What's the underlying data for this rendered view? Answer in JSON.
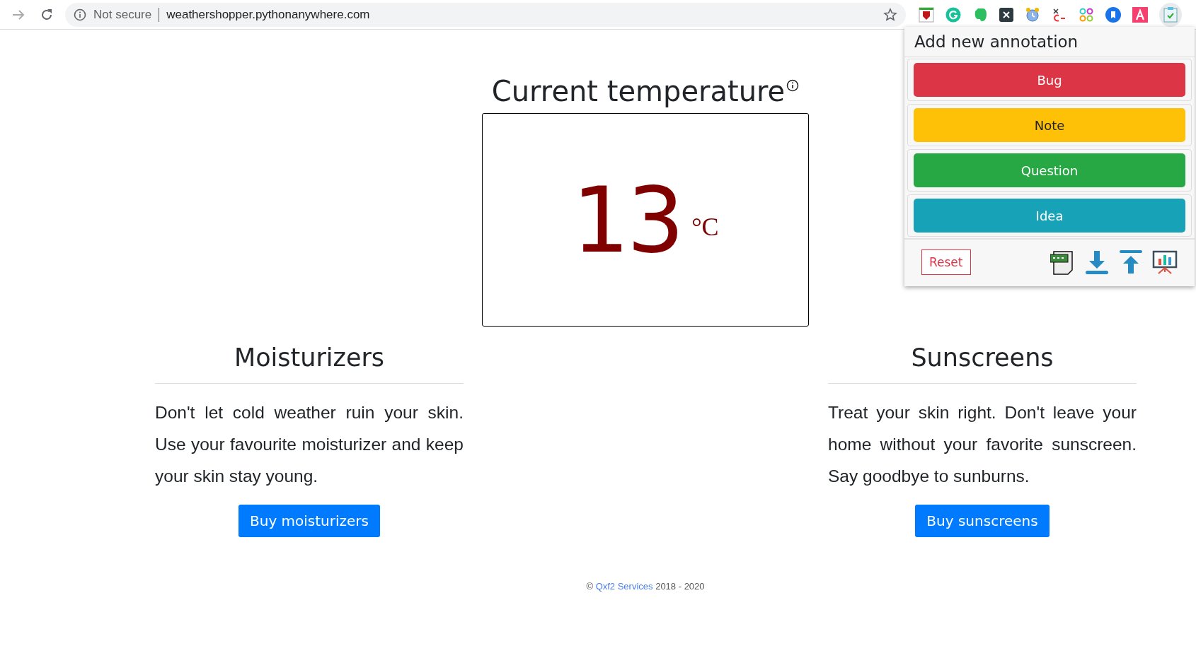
{
  "browser": {
    "security_label": "Not secure",
    "url": "weathershopper.pythonanywhere.com"
  },
  "annotation_popup": {
    "title": "Add new annotation",
    "buttons": [
      {
        "kind": "bug",
        "label": "Bug"
      },
      {
        "kind": "note",
        "label": "Note"
      },
      {
        "kind": "question",
        "label": "Question"
      },
      {
        "kind": "idea",
        "label": "Idea"
      }
    ],
    "reset": "Reset"
  },
  "temperature": {
    "heading": "Current temperature",
    "value": "13",
    "unit": "°C"
  },
  "products": [
    {
      "title": "Moisturizers",
      "description": "Don't let cold weather ruin your skin. Use your favourite moisturizer and keep your skin stay young.",
      "button": "Buy moisturizers"
    },
    {
      "title": "Sunscreens",
      "description": "Treat your skin right. Don't leave your home without your favorite sunscreen. Say goodbye to sunburns.",
      "button": "Buy sunscreens"
    }
  ],
  "footer": {
    "prefix": "©",
    "link": "Qxf2 Services",
    "suffix": "2018 - 2020"
  }
}
